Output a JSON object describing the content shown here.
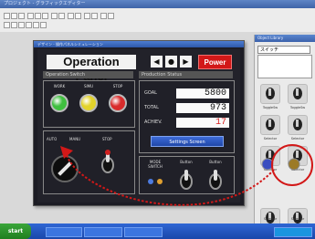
{
  "window": {
    "title": "プロジェクト - グラフィックエディター"
  },
  "taskbar": {
    "start_label": "start"
  },
  "panel": {
    "window_title": "デザイン - 操作パネルシミュレーション",
    "title": "Operation Panel",
    "nav_prev": "◀",
    "nav_home": "●",
    "nav_next": "▶",
    "power_label": "Power",
    "operation_switch_label": "Operation Switch",
    "production_status_label": "Production Status",
    "lamps": [
      {
        "label": "WORK",
        "color": "#3fbf3f"
      },
      {
        "label": "SIMU",
        "color": "#e3d32a"
      },
      {
        "label": "STOP",
        "color": "#d92c2c"
      }
    ],
    "selector": {
      "auto_label": "AUTO",
      "manu_label": "MANU",
      "stop_label": "STOP"
    },
    "counters": [
      {
        "label": "GOAL",
        "value": "5800",
        "color": "#111111"
      },
      {
        "label": "TOTAL",
        "value": "973",
        "color": "#111111"
      },
      {
        "label": "ACHIEV.",
        "value": "17",
        "color": "#d82020"
      }
    ],
    "settings_button": "Settings Screen",
    "bottom": {
      "mode_label": "MODE SWITCH",
      "btn1_label": "Button",
      "btn2_label": "Button"
    }
  },
  "palette": {
    "title": "Object Library",
    "select_value": "スイッチ",
    "items": [
      {
        "label": "ToggleSw"
      },
      {
        "label": "ToggleSw"
      },
      {
        "label": "Selector"
      },
      {
        "label": "Selector"
      },
      {
        "label": "Selector"
      },
      {
        "label": "Selector"
      },
      {
        "label": "Selector"
      },
      {
        "label": "Selector"
      }
    ]
  }
}
